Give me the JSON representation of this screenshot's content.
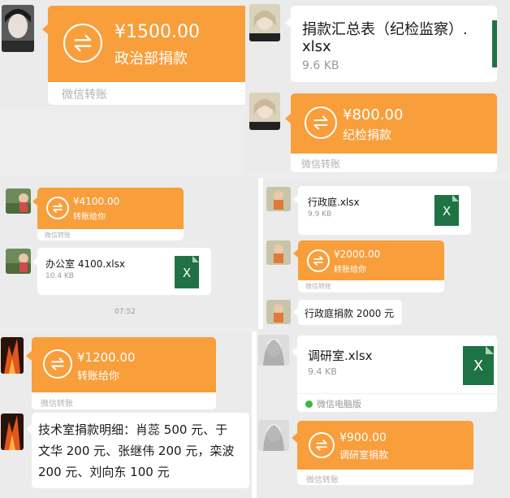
{
  "transfers": {
    "t1": {
      "amount": "¥1500.00",
      "note": "政治部捐款",
      "footer": "微信转账"
    },
    "t2": {
      "amount": "¥800.00",
      "note": "纪检捐款",
      "footer": "微信转账"
    },
    "t3": {
      "amount": "¥4100.00",
      "note": "转账给你",
      "footer": "微信转账"
    },
    "t4": {
      "amount": "¥2000.00",
      "note": "转账给你",
      "footer": "微信转账"
    },
    "t5": {
      "amount": "¥1200.00",
      "note": "转账给你",
      "footer": "微信转账"
    },
    "t6": {
      "amount": "¥900.00",
      "note": "调研室捐款",
      "footer": "微信转账"
    }
  },
  "files": {
    "f1": {
      "line1": "捐款汇总表（纪检监察）.",
      "line2": "xlsx",
      "size": "9.6 KB"
    },
    "f2": {
      "name": "行政庭.xlsx",
      "size": "9.9 KB",
      "icon_letter": "X"
    },
    "f3": {
      "name": "办公室 4100.xlsx",
      "size": "10.4 KB",
      "icon_letter": "X"
    },
    "f4": {
      "name": "调研室.xlsx",
      "size": "9.4 KB",
      "icon_letter": "X",
      "source": "微信电脑版"
    }
  },
  "texts": {
    "m1": "行政庭捐款 2000 元",
    "m2_line1": "技术室捐款明细：肖蕊 500 元、于",
    "m2_line2": "文华 200 元、张继伟 200 元，栾波",
    "m2_line3": "200 元、刘向东 100 元"
  },
  "timestamp": "07:52",
  "colors": {
    "transfer_orange": "#f89e3b",
    "excel_green": "#1f7244",
    "source_icon_green": "#3fb838"
  }
}
